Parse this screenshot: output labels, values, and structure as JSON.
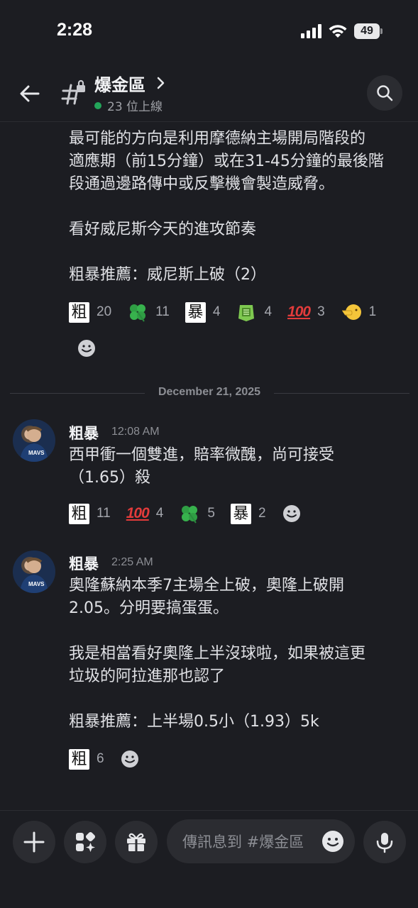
{
  "status_bar": {
    "time": "2:28",
    "battery": "49"
  },
  "header": {
    "channel_name": "爆金區",
    "online_count": "23 位上線"
  },
  "messages": [
    {
      "lines": [
        "最可能的方向是利用摩德納主場開局階段的",
        "適應期（前15分鐘）或在31-45分鐘的最後階",
        "段通過邊路傳中或反擊機會製造威脅。",
        "",
        "看好威尼斯今天的進攻節奏",
        "",
        "粗暴推薦：威尼斯上破（2）"
      ],
      "reactions": [
        {
          "emoji": "粗",
          "count": "20"
        },
        {
          "emoji": "four-leaf-clover",
          "count": "11"
        },
        {
          "emoji": "暴",
          "count": "4"
        },
        {
          "emoji": "green-badge",
          "count": "4"
        },
        {
          "emoji": "100",
          "count": "3"
        },
        {
          "emoji": "pointing-face",
          "count": "1"
        }
      ]
    },
    {
      "author": "粗暴",
      "time": "12:08 AM",
      "lines": [
        "西甲衝一個雙進，賠率微醜，尚可接受",
        "（1.65）殺"
      ],
      "reactions": [
        {
          "emoji": "粗",
          "count": "11"
        },
        {
          "emoji": "100",
          "count": "4"
        },
        {
          "emoji": "four-leaf-clover",
          "count": "5"
        },
        {
          "emoji": "暴",
          "count": "2"
        }
      ]
    },
    {
      "author": "粗暴",
      "time": "2:25 AM",
      "lines": [
        "奧隆蘇納本季7主場全上破，奧隆上破開",
        "2.05。分明要搞蛋蛋。",
        "",
        "我是相當看好奧隆上半沒球啦，如果被這更",
        "垃圾的阿拉進那也認了",
        "",
        "粗暴推薦：上半場0.5小（1.93）5k"
      ],
      "reactions": [
        {
          "emoji": "粗",
          "count": "6"
        }
      ]
    }
  ],
  "date_divider": "December 21, 2025",
  "composer": {
    "placeholder": "傳訊息到 #爆金區"
  },
  "colors": {
    "background": "#1c1d22",
    "online_dot": "#23a55a",
    "button_bg": "#2b2c31"
  }
}
